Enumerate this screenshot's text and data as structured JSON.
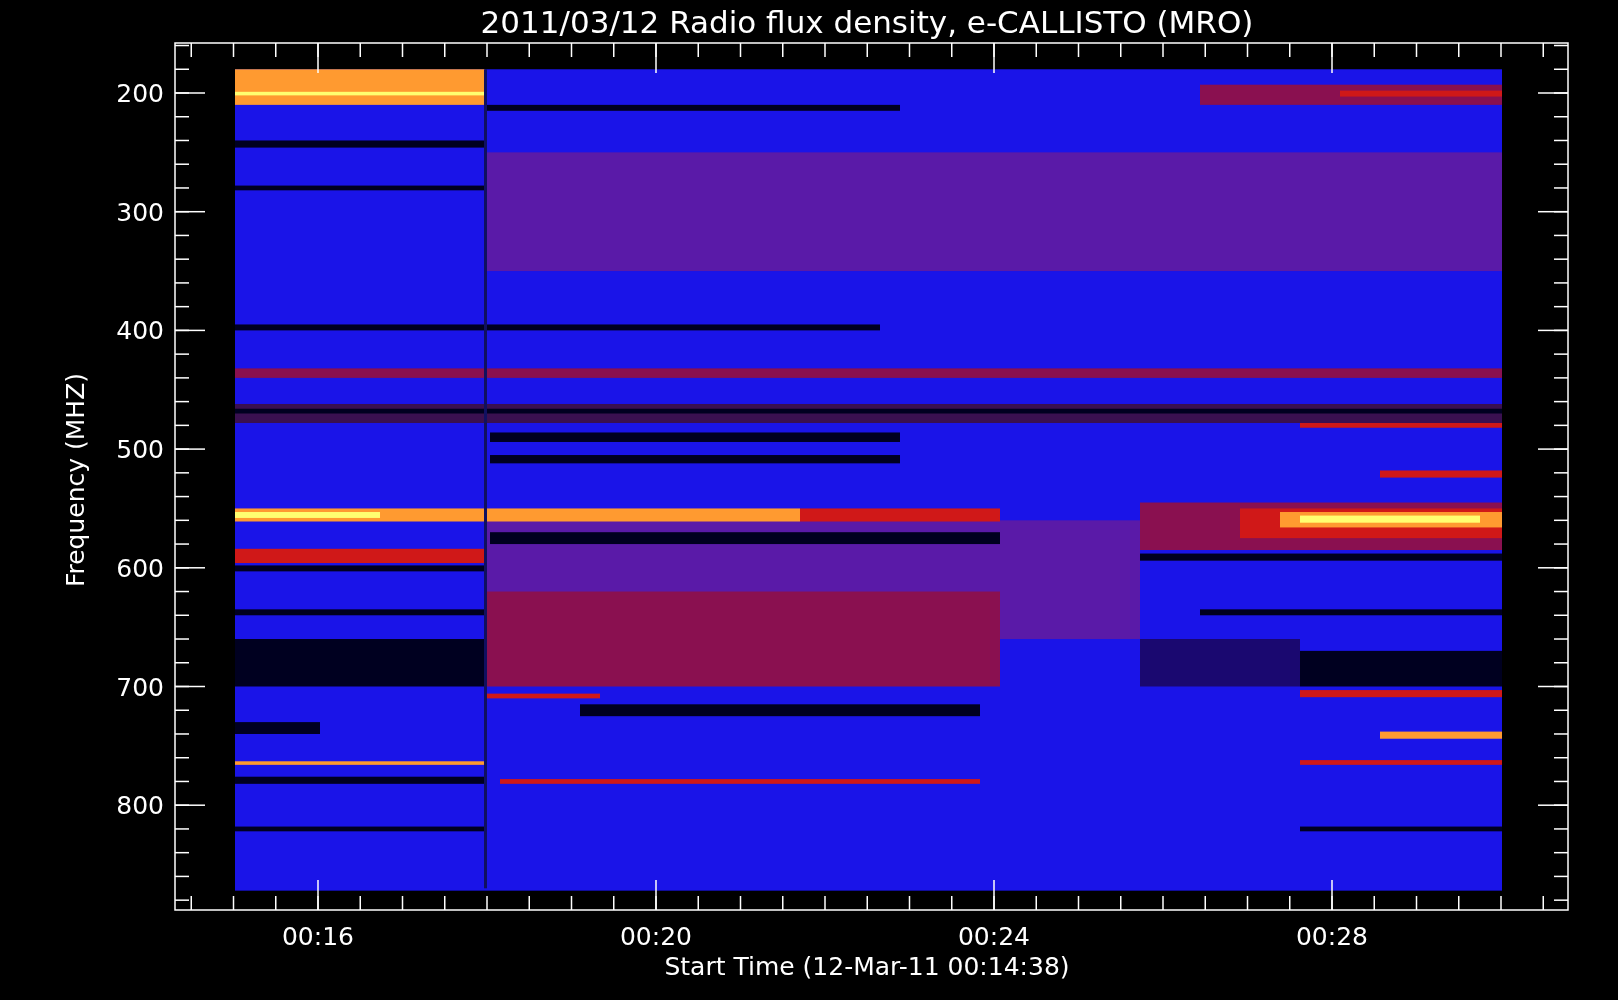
{
  "title": "2011/03/12  Radio flux density, e-CALLISTO (MRO)",
  "y_axis": {
    "label": "Frequency (MHZ)",
    "ticks": [
      "200",
      "300",
      "400",
      "500",
      "600",
      "700",
      "800"
    ]
  },
  "x_axis": {
    "label": "Start Time (12-Mar-11 00:14:38)",
    "ticks": [
      "00:16",
      "00:20",
      "00:24",
      "00:28"
    ]
  }
}
